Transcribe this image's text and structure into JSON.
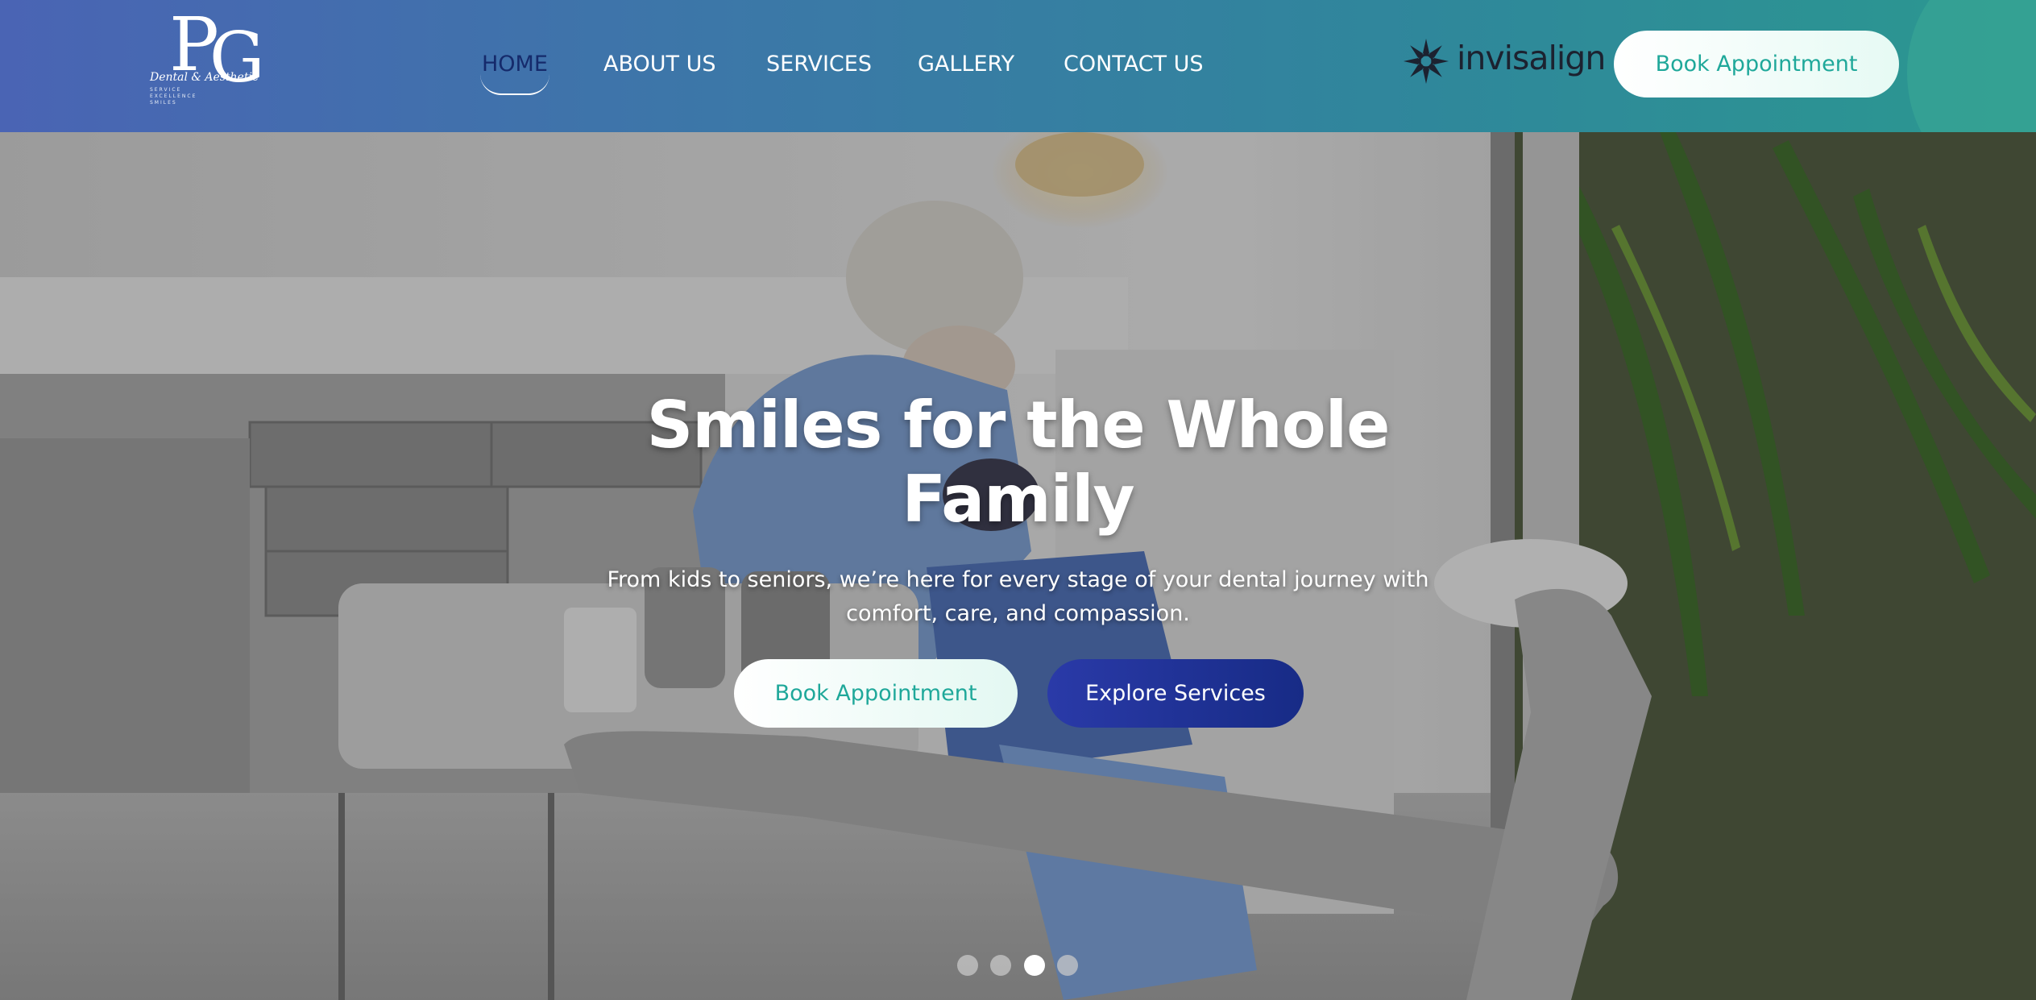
{
  "header": {
    "logo": {
      "monogram": "PG",
      "script": "Dental & Aesthetic",
      "tagline": "SERVICE · EXCELLENCE · SMILES"
    },
    "nav": [
      {
        "label": "HOME",
        "active": true
      },
      {
        "label": "ABOUT US",
        "active": false
      },
      {
        "label": "SERVICES",
        "active": false
      },
      {
        "label": "GALLERY",
        "active": false
      },
      {
        "label": "CONTACT US",
        "active": false
      }
    ],
    "partner": {
      "name": "invisalign",
      "icon": "invisalign-star-icon"
    },
    "cta_label": "Book Appointment"
  },
  "hero": {
    "title": "Smiles for the Whole Family",
    "subtitle": "From kids to seniors, we’re here for every stage of your dental journey with comfort, care, and compassion.",
    "primary_cta": "Book Appointment",
    "secondary_cta": "Explore Services",
    "slides": {
      "count": 4,
      "active_index": 2
    }
  },
  "colors": {
    "header_gradient_start": "#4a64b4",
    "header_gradient_end": "#2b9890",
    "accent_teal": "#1fa89a",
    "accent_navy": "#172b86",
    "active_nav": "#152a6b"
  }
}
